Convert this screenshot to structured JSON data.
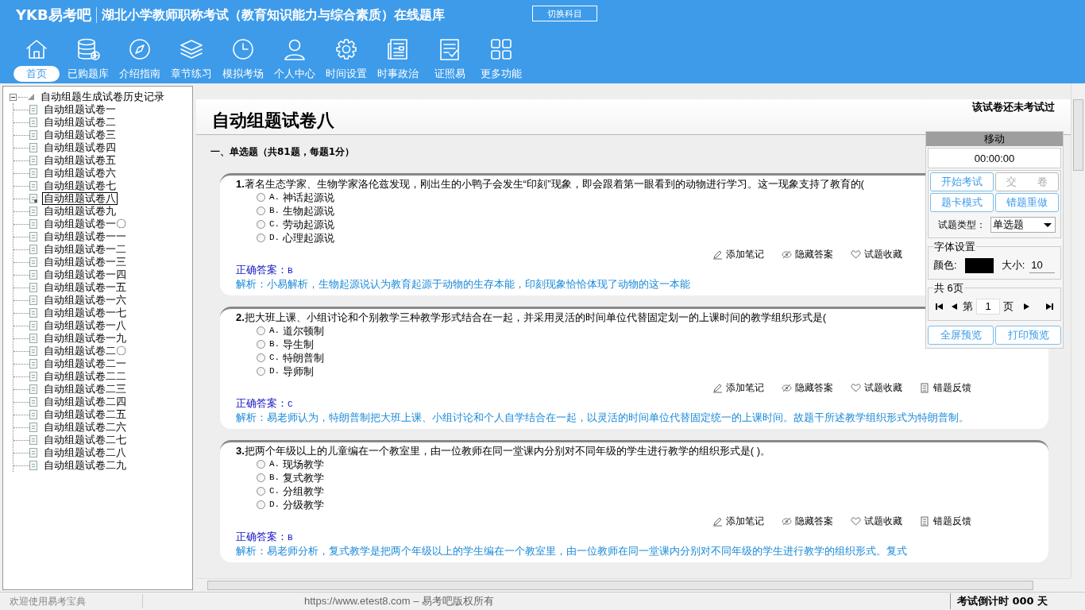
{
  "header": {
    "logo": "YKB易考吧",
    "title": "湖北小学教师职称考试（教育知识能力与综合素质）在线题库",
    "switch_button": "切换科目"
  },
  "nav": [
    {
      "label": "首页",
      "selected": true
    },
    {
      "label": "已购题库",
      "selected": false
    },
    {
      "label": "介绍指南",
      "selected": false
    },
    {
      "label": "章节练习",
      "selected": false
    },
    {
      "label": "模拟考场",
      "selected": false
    },
    {
      "label": "个人中心",
      "selected": false
    },
    {
      "label": "时间设置",
      "selected": false
    },
    {
      "label": "时事政治",
      "selected": false
    },
    {
      "label": "证照易",
      "selected": false
    },
    {
      "label": "更多功能",
      "selected": false
    }
  ],
  "tree": {
    "root": "自动组题生成试卷历史记录",
    "expanded": true,
    "children": [
      {
        "label": "自动组题试卷一",
        "selected": false
      },
      {
        "label": "自动组题试卷二",
        "selected": false
      },
      {
        "label": "自动组题试卷三",
        "selected": false
      },
      {
        "label": "自动组题试卷四",
        "selected": false
      },
      {
        "label": "自动组题试卷五",
        "selected": false
      },
      {
        "label": "自动组题试卷六",
        "selected": false
      },
      {
        "label": "自动组题试卷七",
        "selected": false
      },
      {
        "label": "自动组题试卷八",
        "selected": true
      },
      {
        "label": "自动组题试卷九",
        "selected": false
      },
      {
        "label": "自动组题试卷一〇",
        "selected": false
      },
      {
        "label": "自动组题试卷一一",
        "selected": false
      },
      {
        "label": "自动组题试卷一二",
        "selected": false
      },
      {
        "label": "自动组题试卷一三",
        "selected": false
      },
      {
        "label": "自动组题试卷一四",
        "selected": false
      },
      {
        "label": "自动组题试卷一五",
        "selected": false
      },
      {
        "label": "自动组题试卷一六",
        "selected": false
      },
      {
        "label": "自动组题试卷一七",
        "selected": false
      },
      {
        "label": "自动组题试卷一八",
        "selected": false
      },
      {
        "label": "自动组题试卷一九",
        "selected": false
      },
      {
        "label": "自动组题试卷二〇",
        "selected": false
      },
      {
        "label": "自动组题试卷二一",
        "selected": false
      },
      {
        "label": "自动组题试卷二二",
        "selected": false
      },
      {
        "label": "自动组题试卷二三",
        "selected": false
      },
      {
        "label": "自动组题试卷二四",
        "selected": false
      },
      {
        "label": "自动组题试卷二五",
        "selected": false
      },
      {
        "label": "自动组题试卷二六",
        "selected": false
      },
      {
        "label": "自动组题试卷二七",
        "selected": false
      },
      {
        "label": "自动组题试卷二八",
        "selected": false
      },
      {
        "label": "自动组题试卷二九",
        "selected": false
      }
    ]
  },
  "exam": {
    "title": "自动组题试卷八",
    "status": "该试卷还未考试过",
    "section": "一、单选题（共81题，每题1分）",
    "questions": [
      {
        "number": "1.",
        "text": "著名生态学家、生物学家洛伦兹发现，刚出生的小鸭子会发生“印刻”现象，即会跟着第一眼看到的动物进行学习。这一现象支持了教育的(",
        "options": [
          {
            "label": "A.",
            "text": "神话起源说",
            "selected": false
          },
          {
            "label": "B.",
            "text": "生物起源说",
            "selected": false
          },
          {
            "label": "C.",
            "text": "劳动起源说",
            "selected": false
          },
          {
            "label": "D.",
            "text": "心理起源说",
            "selected": false
          }
        ],
        "actions": [
          "添加笔记",
          "隐藏答案",
          "试题收藏"
        ],
        "answer_label": "正确答案：",
        "answer": "B",
        "analysis": "解析：小易解析，生物起源说认为教育起源于动物的生存本能，印刻现象恰恰体现了动物的这一本能"
      },
      {
        "number": "2.",
        "text": "把大班上课、小组讨论和个别教学三种教学形式结合在一起，并采用灵活的时间单位代替固定划一的上课时间的教学组织形式是(",
        "options": [
          {
            "label": "A.",
            "text": "道尔顿制",
            "selected": false
          },
          {
            "label": "B.",
            "text": "导生制",
            "selected": false
          },
          {
            "label": "C.",
            "text": "特朗普制",
            "selected": false
          },
          {
            "label": "D.",
            "text": "导师制",
            "selected": false
          }
        ],
        "actions": [
          "添加笔记",
          "隐藏答案",
          "试题收藏",
          "错题反馈"
        ],
        "answer_label": "正确答案：",
        "answer": "C",
        "analysis": "解析：易老师认为，特朗普制把大班上课、小组讨论和个人自学结合在一起，以灵活的时间单位代替固定统一的上课时间。故题干所述教学组织形式为特朗普制。"
      },
      {
        "number": "3.",
        "text": "把两个年级以上的儿童编在一个教室里，由一位教师在同一堂课内分别对不同年级的学生进行教学的组织形式是( )。",
        "options": [
          {
            "label": "A.",
            "text": "现场教学",
            "selected": false
          },
          {
            "label": "B.",
            "text": "复式教学",
            "selected": false
          },
          {
            "label": "C.",
            "text": "分组教学",
            "selected": false
          },
          {
            "label": "D.",
            "text": "分级教学",
            "selected": false
          }
        ],
        "actions": [
          "添加笔记",
          "隐藏答案",
          "试题收藏",
          "错题反馈"
        ],
        "answer_label": "正确答案：",
        "answer": "B",
        "analysis": "解析：易老师分析，复式教学是把两个年级以上的学生编在一个教室里，由一位教师在同一堂课内分别对不同年级的学生进行教学的组织形式。复式"
      }
    ]
  },
  "panel": {
    "handle": "移动",
    "timer": "00:00:00",
    "buttons": [
      {
        "label": "开始考试",
        "disabled": false
      },
      {
        "label": "交　　卷",
        "disabled": true
      },
      {
        "label": "题卡模式",
        "disabled": false
      },
      {
        "label": "错题重做",
        "disabled": false
      }
    ],
    "type_label": "试题类型：",
    "type_value": "单选题",
    "font_group": "字体设置",
    "color_label": "颜色:",
    "color": "#000000",
    "size_label": "大小:",
    "size": "10",
    "pages_group": "共 6页",
    "page_prefix": "第",
    "page": "1",
    "page_suffix": "页",
    "preview_buttons": [
      "全屏预览",
      "打印预览"
    ]
  },
  "status_bar": {
    "welcome": "欢迎使用易考宝典",
    "copyright": "https://www.etest8.com – 易考吧版权所有",
    "countdown": "考试倒计时 000 天"
  }
}
